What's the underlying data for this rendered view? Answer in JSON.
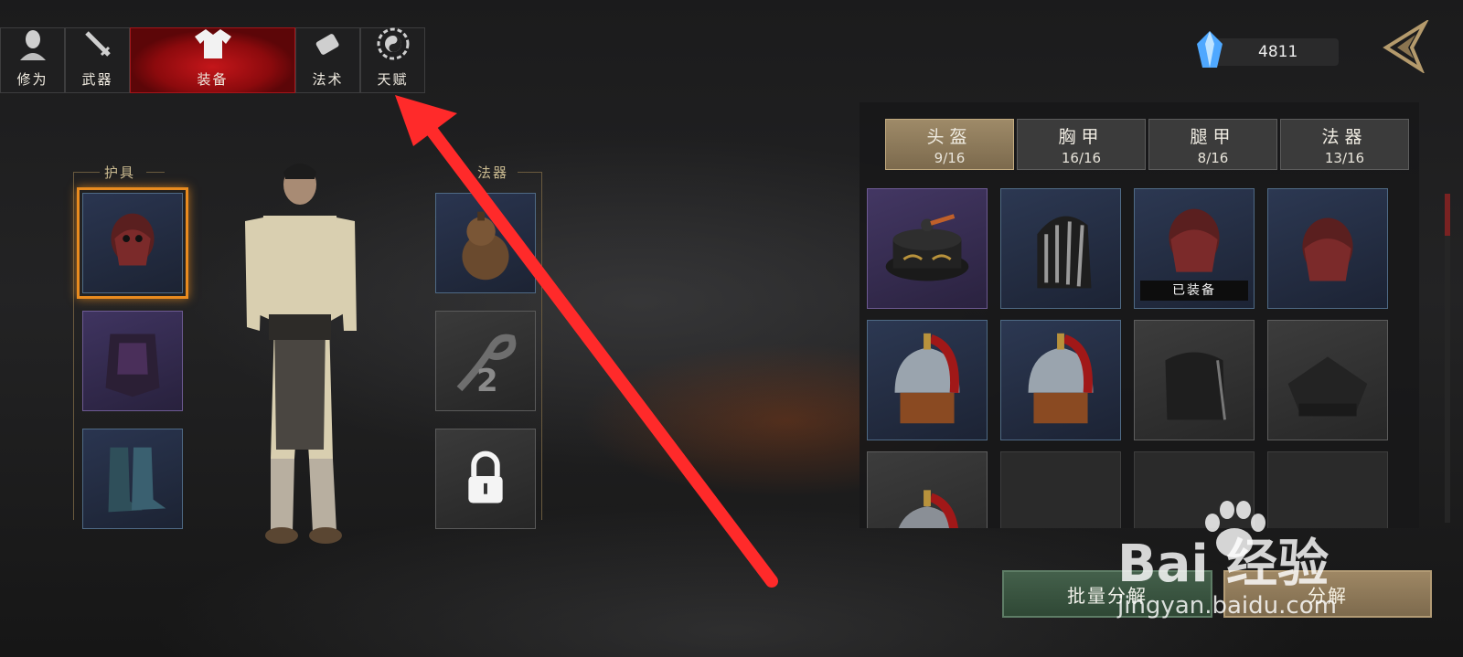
{
  "top_tabs": [
    {
      "label": "修为",
      "icon": "cultivation-head-icon"
    },
    {
      "label": "武器",
      "icon": "sword-icon"
    },
    {
      "label": "装备",
      "icon": "robe-icon",
      "active": true
    },
    {
      "label": "法术",
      "icon": "scroll-icon"
    },
    {
      "label": "天赋",
      "icon": "yin-yang-icon"
    }
  ],
  "currency": {
    "value": "4811",
    "icon": "blue-crystal-icon"
  },
  "left_sections": {
    "armor_title": "护具",
    "artifact_title": "法器"
  },
  "artifact_slots": {
    "slot2_number": "2"
  },
  "category_tabs": [
    {
      "name": "头盔",
      "count": "9/16",
      "active": true
    },
    {
      "name": "胸甲",
      "count": "16/16"
    },
    {
      "name": "腿甲",
      "count": "8/16"
    },
    {
      "name": "法器",
      "count": "13/16"
    }
  ],
  "inventory": {
    "equipped_label": "已装备"
  },
  "buttons": {
    "batch_decompose": "批量分解",
    "decompose": "分解"
  },
  "watermark": {
    "main": "Bai 经验",
    "sub": "jingyan.baidu.com"
  },
  "colors": {
    "active_tab": "#c4161a",
    "selected_frame": "#e98b1f",
    "arrow": "#ff2a2a",
    "batch_button": "#44604b",
    "decompose_button": "#9e8764"
  }
}
